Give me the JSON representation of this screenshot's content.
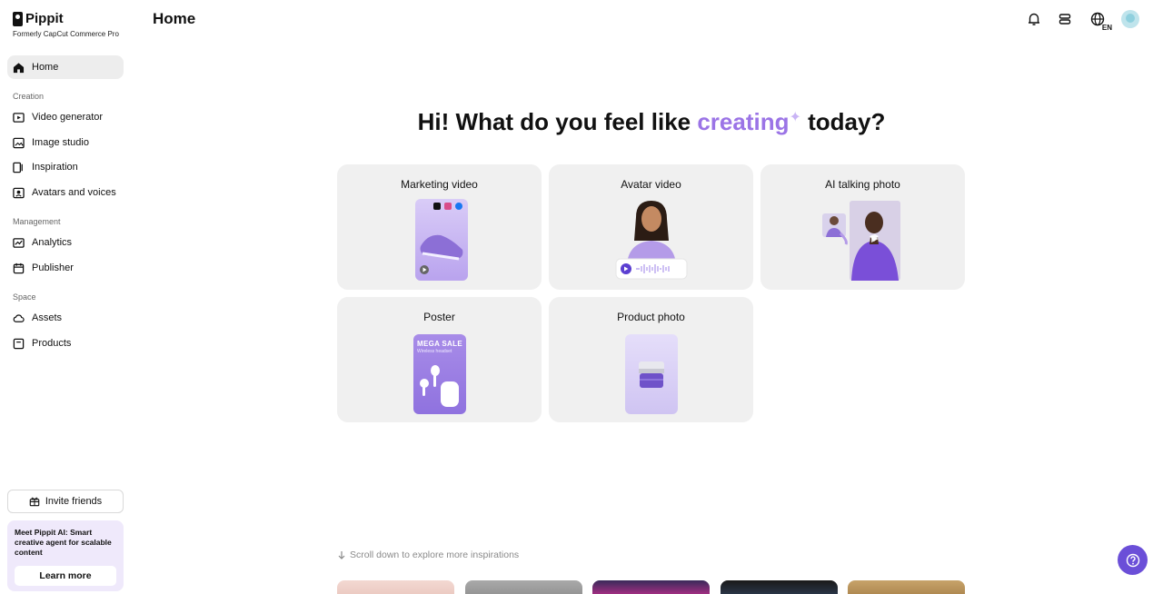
{
  "brand": {
    "name": "Pippit",
    "subtitle": "Formerly CapCut Commerce Pro"
  },
  "header": {
    "title": "Home",
    "language": "EN"
  },
  "sidebar": {
    "home": "Home",
    "sections": [
      {
        "label": "Creation",
        "items": [
          "Video generator",
          "Image studio",
          "Inspiration",
          "Avatars and voices"
        ]
      },
      {
        "label": "Management",
        "items": [
          "Analytics",
          "Publisher"
        ]
      },
      {
        "label": "Space",
        "items": [
          "Assets",
          "Products"
        ]
      }
    ],
    "invite": "Invite friends",
    "promo": {
      "text": "Meet Pippit AI: Smart creative agent for scalable content",
      "button": "Learn more"
    }
  },
  "main": {
    "headline_pre": "Hi! What do you feel like ",
    "headline_accent": "creating",
    "headline_post": " today?",
    "cards": [
      {
        "title": "Marketing video"
      },
      {
        "title": "Avatar video"
      },
      {
        "title": "AI talking photo"
      },
      {
        "title": "Poster"
      },
      {
        "title": "Product photo"
      }
    ],
    "poster_thumb": {
      "line1": "MEGA SALE",
      "line2": "Wireless headset"
    },
    "scroll_hint": "Scroll down to explore more inspirations"
  },
  "colors": {
    "accent": "#9b74e6",
    "help_button": "#6b4fd8",
    "card_bg": "#f0f0f0"
  }
}
